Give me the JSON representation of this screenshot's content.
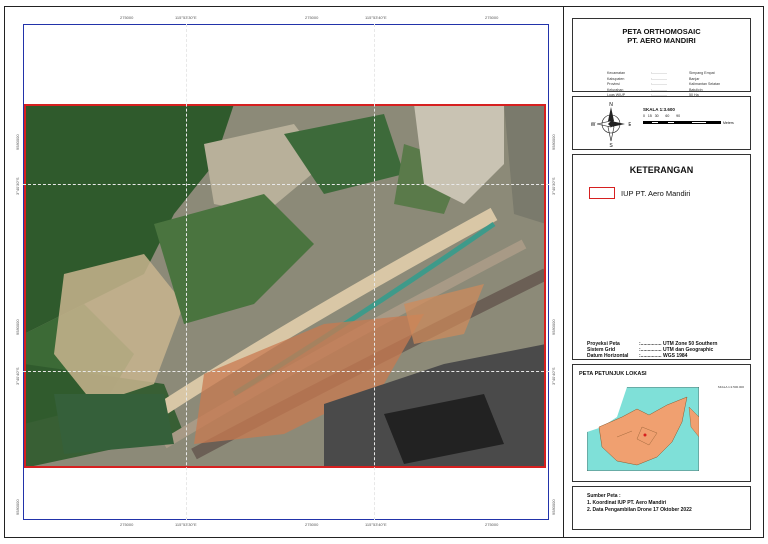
{
  "map": {
    "grid_x_labels": [
      "275000",
      "275000",
      "275000",
      "275000"
    ],
    "grid_y_labels": [
      "9580000",
      "9580000",
      "9580000",
      "9580000"
    ],
    "geo_x_labels": [
      "115°53'30\"E",
      "115°53'40\"E"
    ],
    "geo_y_labels": [
      "3°40'30\"S",
      "3°40'40\"S"
    ]
  },
  "title": {
    "line1": "PETA ORTHOMOSAIC",
    "line2": "PT. AERO MANDIRI"
  },
  "admin_info": [
    {
      "key": "Kecamatan",
      "value": "Simpang Empat"
    },
    {
      "key": "Kabupaten",
      "value": "Banjar"
    },
    {
      "key": "Provinsi",
      "value": "Kalimantan Selatan"
    },
    {
      "key": "Kelurahan",
      "value": "Batulicin"
    },
    {
      "key": "Luas WIUP",
      "value": "50 Ha"
    }
  ],
  "scale": {
    "label": "SKALA 1:3.600",
    "ticks": [
      "0",
      "15",
      "30",
      "60",
      "90"
    ],
    "unit": "Meters"
  },
  "north_arrow": {
    "n": "N",
    "s": "S",
    "e": "E",
    "w": "W"
  },
  "legend": {
    "title": "KETERANGAN",
    "items": [
      {
        "label": "IUP PT. Aero Mandiri",
        "color": "#d62020"
      }
    ]
  },
  "projection": [
    {
      "key": "Proyeksi Peta",
      "value": "UTM Zone 50 Southern"
    },
    {
      "key": "Sistem Grid",
      "value": "UTM dan Geographic"
    },
    {
      "key": "Datum Horizontal",
      "value": "WGS 1984"
    }
  ],
  "location_map": {
    "title": "PETA PETUNJUK LOKASI",
    "scale": "SKALA 1:2.500.000",
    "land_color": "#f0a070",
    "sea_color": "#7fe0d8",
    "other_land_color": "#ffffff"
  },
  "sources": {
    "title": "Sumber Peta :",
    "items": [
      "1. Koordinat IUP PT. Aero Mandiri",
      "2. Data Pengambilan Drone 17 Oktober 2022"
    ]
  }
}
